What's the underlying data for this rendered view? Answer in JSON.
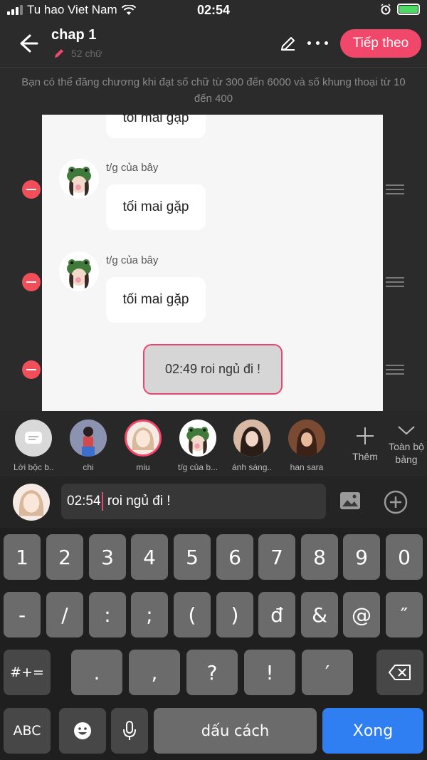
{
  "status_bar": {
    "carrier": "Tu hao Viet Nam",
    "time": "02:54"
  },
  "header": {
    "title": "chap 1",
    "word_count": "52 chữ",
    "next_button": "Tiếp theo"
  },
  "notice": "Bạn có thể đăng chương khi đạt số chữ từ 300 đến 6000 và số khung thoại từ 10 đến 400",
  "chat": {
    "top_bubble": "tối mai gặp",
    "messages": [
      {
        "sender": "t/g của bây",
        "text": "tối mai gặp"
      },
      {
        "sender": "t/g của bây",
        "text": "tối mai gặp"
      }
    ],
    "my_message": "02:49 roi ngủ đi !"
  },
  "characters": [
    {
      "label": "Lời bộc b..."
    },
    {
      "label": "chi"
    },
    {
      "label": "miu"
    },
    {
      "label": "t/g của b..."
    },
    {
      "label": "ánh sáng..."
    },
    {
      "label": "han sara"
    }
  ],
  "add_more_label": "Thêm",
  "collapse_label": "Toàn bộ bảng",
  "input": {
    "before_caret": "02:54",
    "after_caret": " roi ngủ đi !"
  },
  "keyboard": {
    "row1": [
      "1",
      "2",
      "3",
      "4",
      "5",
      "6",
      "7",
      "8",
      "9",
      "0"
    ],
    "row2": [
      "-",
      "/",
      ":",
      ";",
      "(",
      ")",
      "đ",
      "&",
      "@",
      "″"
    ],
    "row3": [
      ".",
      ",",
      "?",
      "!",
      "′"
    ],
    "symbols_key": "#+=",
    "abc_key": "ABC",
    "space_key": "dấu cách",
    "done_key": "Xong"
  },
  "colors": {
    "accent": "#f1476a",
    "delete": "#f24e5a",
    "done": "#2f7ff2"
  }
}
